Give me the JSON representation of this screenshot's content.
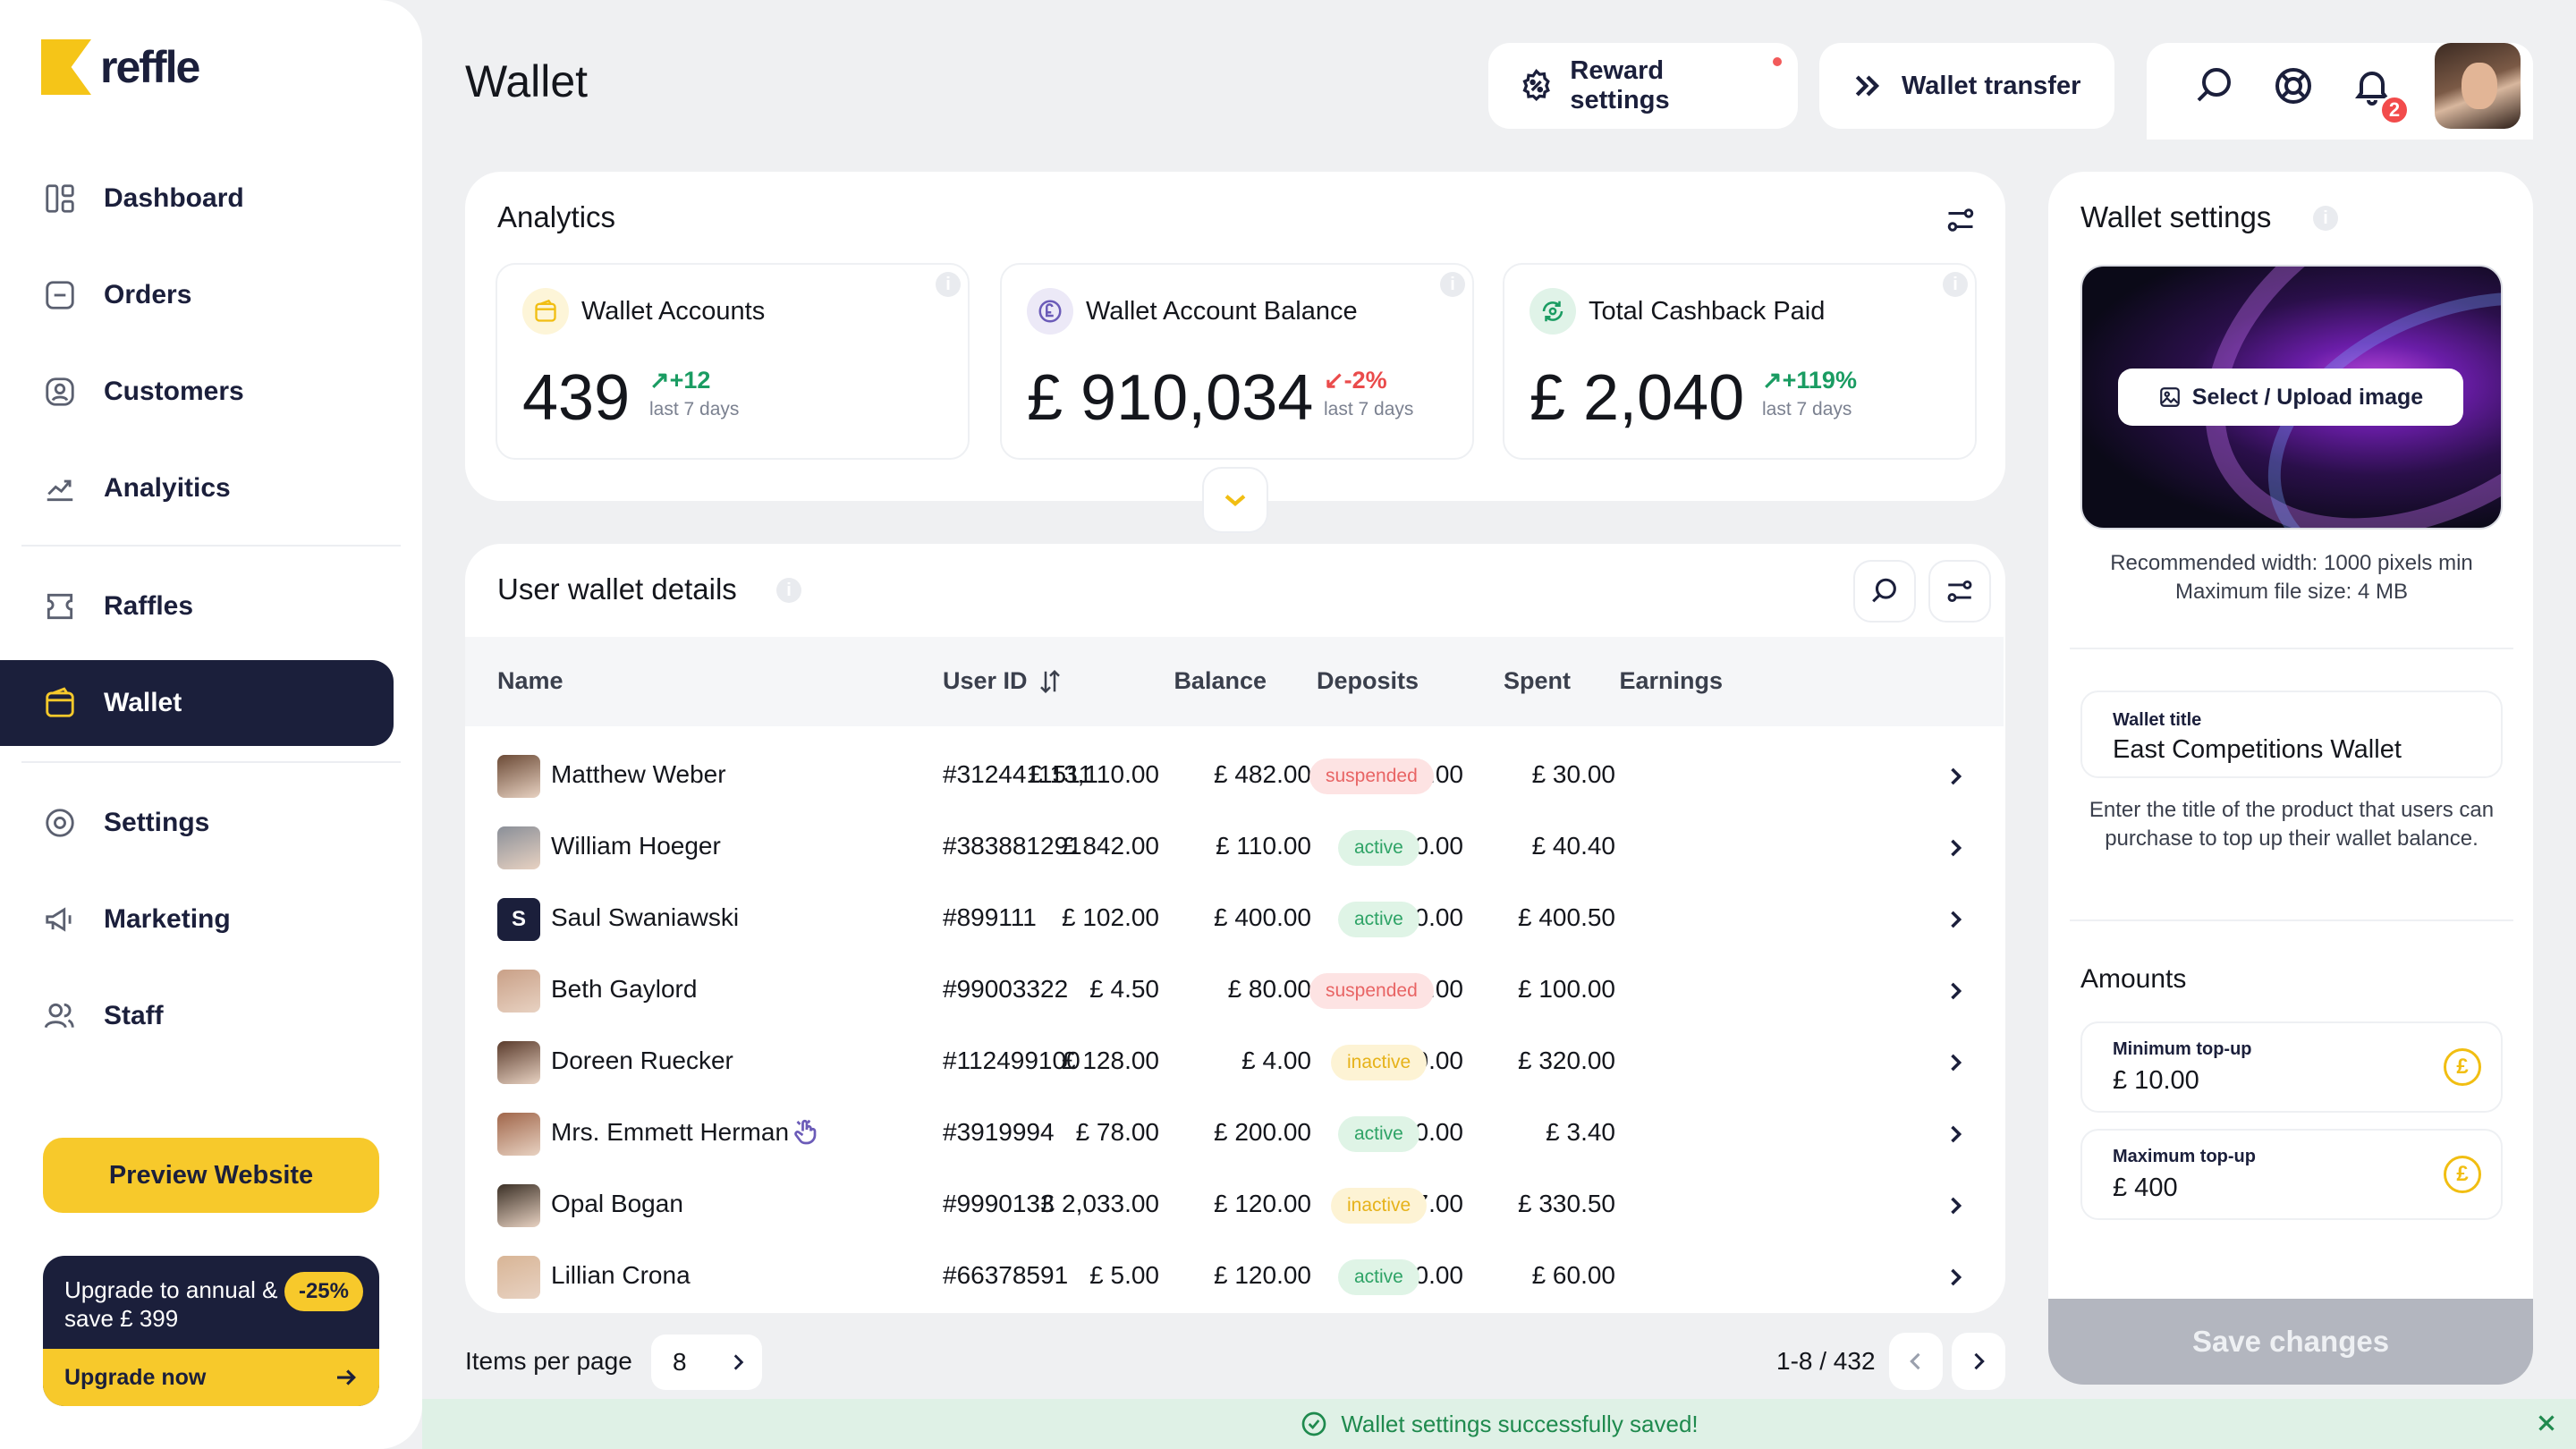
{
  "brand": {
    "name": "reffle"
  },
  "sidebar": {
    "items": [
      {
        "label": "Dashboard",
        "icon": "dashboard-icon"
      },
      {
        "label": "Orders",
        "icon": "orders-icon"
      },
      {
        "label": "Customers",
        "icon": "customers-icon"
      },
      {
        "label": "Analyitics",
        "icon": "analytics-icon"
      },
      {
        "label": "Raffles",
        "icon": "raffles-icon"
      },
      {
        "label": "Wallet",
        "icon": "wallet-icon",
        "active": true
      },
      {
        "label": "Settings",
        "icon": "settings-icon"
      },
      {
        "label": "Marketing",
        "icon": "megaphone-icon"
      },
      {
        "label": "Staff",
        "icon": "staff-icon"
      }
    ],
    "preview_label": "Preview Website",
    "upgrade": {
      "text": "Upgrade to annual & save £ 399",
      "badge": "-25%",
      "cta": "Upgrade now"
    }
  },
  "header": {
    "title": "Wallet",
    "reward_settings": "Reward settings",
    "wallet_transfer": "Wallet transfer",
    "notification_count": "2"
  },
  "analytics": {
    "title": "Analytics",
    "stats": [
      {
        "label": "Wallet Accounts",
        "value": "439",
        "change": "+12",
        "direction": "up",
        "period": "last 7 days"
      },
      {
        "label": "Wallet Account Balance",
        "value": "£ 910,034",
        "change": "-2%",
        "direction": "down",
        "period": "last 7 days"
      },
      {
        "label": "Total Cashback Paid",
        "value": "£ 2,040",
        "change": "+119%",
        "direction": "up",
        "period": "last 7 days"
      }
    ]
  },
  "table": {
    "title": "User wallet details",
    "columns": {
      "name": "Name",
      "user_id": "User ID",
      "balance": "Balance",
      "deposits": "Deposits",
      "spent": "Spent",
      "earnings": "Earnings"
    },
    "rows": [
      {
        "name": "Matthew Weber",
        "id": "#3124411511",
        "balance": "£ 13,110.00",
        "deposits": "£ 482.00",
        "spent": "£ 300.00",
        "earnings": "£ 30.00",
        "status": "suspended"
      },
      {
        "name": "William Hoeger",
        "id": "#383881291",
        "balance": "£ 842.00",
        "deposits": "£ 110.00",
        "spent": "£ 540.00",
        "earnings": "£ 40.40",
        "status": "active"
      },
      {
        "name": "Saul Swaniawski",
        "id": "#899111",
        "balance": "£ 102.00",
        "deposits": "£ 400.00",
        "spent": "£ 10.00",
        "earnings": "£ 400.50",
        "status": "active",
        "initial": "S"
      },
      {
        "name": "Beth Gaylord",
        "id": "#99003322",
        "balance": "£ 4.50",
        "deposits": "£ 80.00",
        "spent": "£ 2,110.00",
        "earnings": "£ 100.00",
        "status": "suspended"
      },
      {
        "name": "Doreen Ruecker",
        "id": "#112499100",
        "balance": "£ 128.00",
        "deposits": "£ 4.00",
        "spent": "£ 50.00",
        "earnings": "£ 320.00",
        "status": "inactive"
      },
      {
        "name": "Mrs. Emmett Herman",
        "id": "#3919994",
        "balance": "£ 78.00",
        "deposits": "£ 200.00",
        "spent": "£ 500.00",
        "earnings": "£ 3.40",
        "status": "active"
      },
      {
        "name": "Opal Bogan",
        "id": "#9990133",
        "balance": "£ 2,033.00",
        "deposits": "£ 120.00",
        "spent": "£ 87.00",
        "earnings": "£ 330.50",
        "status": "inactive"
      },
      {
        "name": "Lillian Crona",
        "id": "#66378591",
        "balance": "£ 5.00",
        "deposits": "£ 120.00",
        "spent": "£ 700.00",
        "earnings": "£ 60.00",
        "status": "active"
      }
    ],
    "items_per_page_label": "Items per page",
    "items_per_page": "8",
    "range": "1-8 / 432"
  },
  "wallet_settings": {
    "title": "Wallet settings",
    "upload_label": "Select / Upload image",
    "image_note_1": "Recommended width: 1000 pixels min",
    "image_note_2": "Maximum file size: 4 MB",
    "wallet_title_label": "Wallet title",
    "wallet_title_value": "East Competitions Wallet",
    "wallet_title_help": "Enter the title of the product that users can purchase to top up their wallet balance.",
    "amounts_title": "Amounts",
    "min_label": "Minimum top-up",
    "min_value": "£ 10.00",
    "max_label": "Maximum top-up",
    "max_value": "£ 400",
    "currency_symbol": "£",
    "save_label": "Save changes"
  },
  "toast": {
    "message": "Wallet settings successfully saved!"
  },
  "colors": {
    "brand_yellow": "#f7c92b",
    "navy": "#1b1f3b",
    "success": "#1f8a4e",
    "danger": "#ea4b4b"
  }
}
